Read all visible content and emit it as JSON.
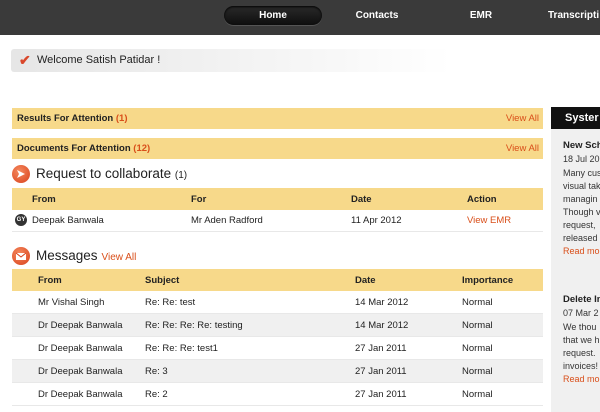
{
  "nav": {
    "tabs": [
      {
        "label": "Home",
        "active": true
      },
      {
        "label": "Contacts",
        "active": false
      },
      {
        "label": "EMR",
        "active": false
      },
      {
        "label": "Transcripti",
        "active": false
      }
    ]
  },
  "welcome": {
    "icon": "check-icon",
    "text": "Welcome Satish Patidar !"
  },
  "attention": [
    {
      "label": "Results For Attention",
      "count": "(1)",
      "view_label": "View All"
    },
    {
      "label": "Documents For Attention",
      "count": "(12)",
      "view_label": "View All"
    }
  ],
  "collaborate": {
    "icon": "arrow-icon",
    "title": "Request to collaborate",
    "count": "(1)",
    "columns": [
      "From",
      "For",
      "Date",
      "Action"
    ],
    "rows": [
      {
        "avatar": "GY",
        "from": "Deepak Banwala",
        "for": "Mr Aden Radford",
        "date": "11 Apr 2012",
        "action": "View EMR"
      }
    ]
  },
  "messages": {
    "icon": "envelope-icon",
    "title": "Messages",
    "view_label": "View All",
    "columns": [
      "From",
      "Subject",
      "Date",
      "Importance"
    ],
    "rows": [
      {
        "from": "Mr Vishal Singh",
        "subject": "Re: Re: test",
        "date": "14 Mar 2012",
        "importance": "Normal"
      },
      {
        "from": "Dr Deepak Banwala",
        "subject": "Re: Re: Re: Re: testing",
        "date": "14 Mar 2012",
        "importance": "Normal"
      },
      {
        "from": "Dr Deepak Banwala",
        "subject": "Re: Re: Re: test1",
        "date": "27 Jan 2011",
        "importance": "Normal"
      },
      {
        "from": "Dr Deepak Banwala",
        "subject": "Re: 3",
        "date": "27 Jan 2011",
        "importance": "Normal"
      },
      {
        "from": "Dr Deepak Banwala",
        "subject": "Re: 2",
        "date": "27 Jan 2011",
        "importance": "Normal"
      }
    ]
  },
  "sidebar": {
    "title": "Syster",
    "news": [
      {
        "title": "New Sch",
        "date": "18 Jul 20",
        "lines": [
          "Many cus",
          "visual tak",
          "managin",
          "Though v",
          "request, ",
          "released"
        ],
        "more": "Read mo"
      },
      {
        "title": "Delete In",
        "date": "07 Mar 2",
        "lines": [
          "We thou",
          "that we h",
          "request. ",
          "invoices!"
        ],
        "more": "Read mo"
      }
    ]
  }
}
